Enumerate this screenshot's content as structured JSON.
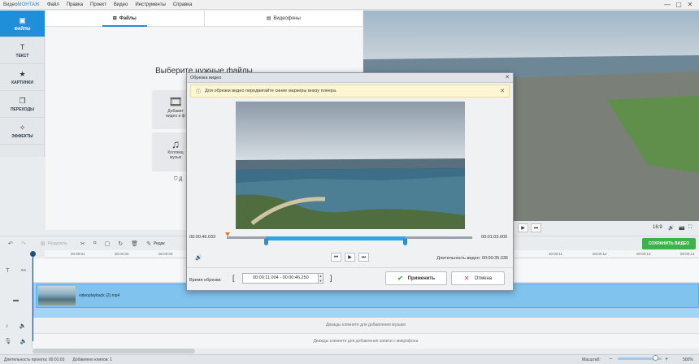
{
  "app": {
    "title_prefix": "Видео",
    "title_brand": "МОНТАЖ",
    "menu": [
      "Файл",
      "Правка",
      "Проект",
      "Видео",
      "Инструменты",
      "Справка"
    ],
    "window_buttons": [
      "—",
      "▢",
      "✕"
    ]
  },
  "sidebar": {
    "items": [
      {
        "label": "ФАЙЛЫ",
        "icon": "▣"
      },
      {
        "label": "ТЕКСТ",
        "icon": "T"
      },
      {
        "label": "КАРТИНКИ",
        "icon": "★"
      },
      {
        "label": "ПЕРЕХОДЫ",
        "icon": "❐"
      },
      {
        "label": "ЭФФЕКТЫ",
        "icon": "✧"
      }
    ]
  },
  "files_panel": {
    "tabs": [
      {
        "label": "Файлы",
        "icon": "⊞"
      },
      {
        "label": "Видеофоны",
        "icon": "▤"
      }
    ],
    "choose_title": "Выберите нужные файлы",
    "choose_sub": "или просто пер",
    "card_add": {
      "line1": "Добавит",
      "line2": "видео и ф",
      "icon": "🎞"
    },
    "card_music": {
      "line1": "Коллекц",
      "line2": "музык",
      "icon": "♫"
    },
    "gift_icon": "⛉",
    "gift_text": "Д"
  },
  "player": {
    "buttons": [
      "▶",
      "⏭"
    ],
    "ratio": "16:9",
    "icons": [
      "🔊",
      "📷",
      "⛶"
    ]
  },
  "toolbar": {
    "split_label": "Разделить",
    "edit_label": "Редак",
    "save_label": "СОХРАНИТЬ ВИДЕО"
  },
  "ruler": {
    "ticks": [
      "00:00:01",
      "00:00:02",
      "00:00:03",
      "00:00:11",
      "00:00:12",
      "00:00:13",
      "00:00:14",
      "00:00:15"
    ]
  },
  "timeline": {
    "clip_name": "videoplayback (2).mp4",
    "music_hint": "Дважды кликните для добавления музыки",
    "voice_hint": "Дважды кликните для добавления записи с микрофона"
  },
  "status": {
    "duration_label": "Длительность проекта: 00:01:03",
    "clips_label": "Добавлено клипов: 1",
    "zoom_label": "Масштаб:",
    "zoom_value": "500%",
    "zoom_fraction": 0.85
  },
  "dialog": {
    "title": "Обрезка видео",
    "notice": "Для обрезки видео передвигайте синие маркеры внизу плеера.",
    "time_start": "00:00:46.033",
    "time_end": "00:01:03.000",
    "duration": "Длительность видео: 00:00:35.036",
    "trim_label": "Время обрезки:",
    "trim_value": "00:00:11.004 - 00:00:46.250",
    "apply": "Применить",
    "cancel": "Отмена",
    "selection_start": 0.16,
    "selection_end": 0.73
  }
}
